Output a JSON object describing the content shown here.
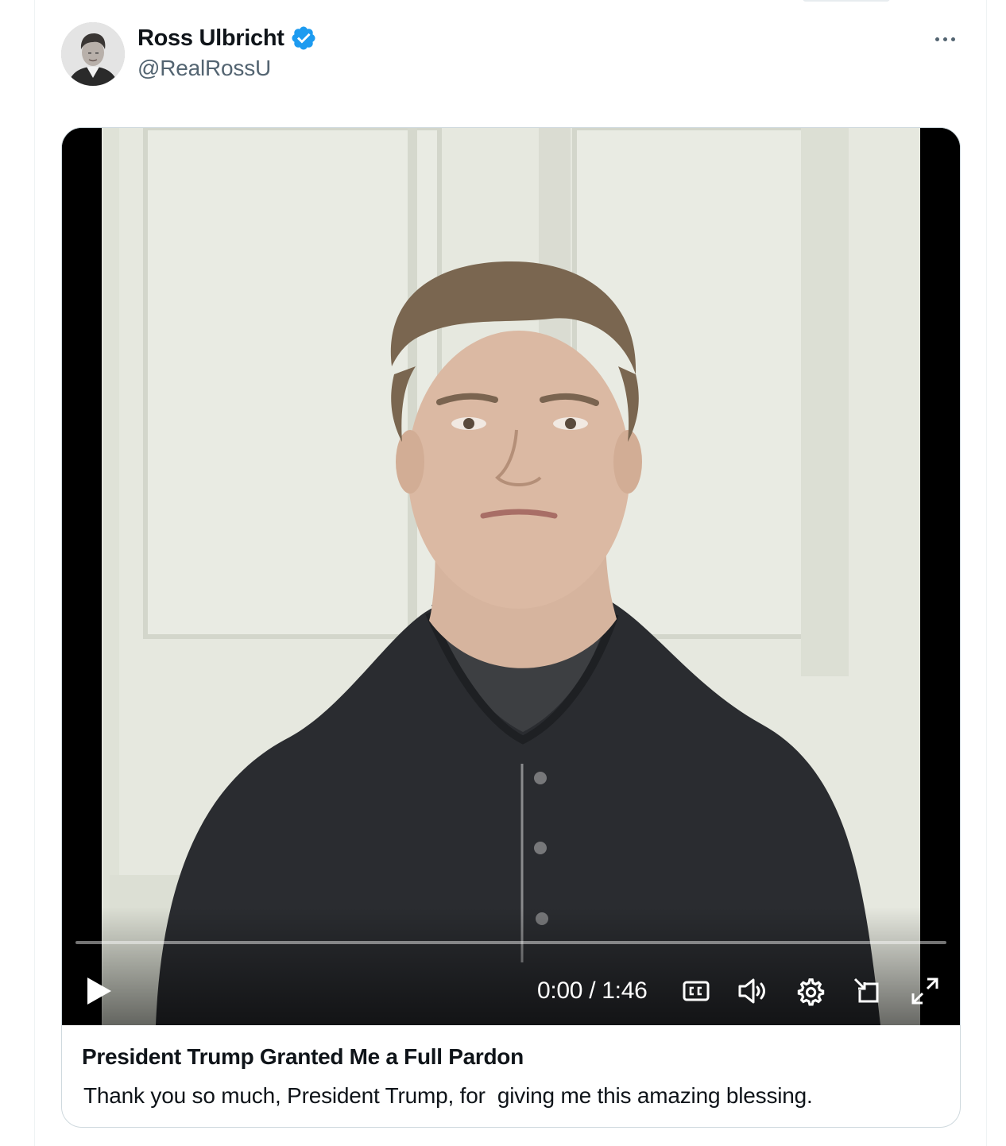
{
  "post": {
    "author": {
      "display_name": "Ross Ulbricht",
      "handle": "@RealRossU",
      "verified": true,
      "avatar_icon": "profile-photo"
    },
    "more_icon": "more-horizontal-icon"
  },
  "video": {
    "state": "paused",
    "progress": 0,
    "time_label": "0:00 / 1:46",
    "controls": [
      "play-icon",
      "captions-icon",
      "volume-icon",
      "settings-icon",
      "pop-out-icon",
      "fullscreen-icon"
    ]
  },
  "card": {
    "title": "President Trump Granted Me a Full Pardon",
    "description": "Thank you so much, President Trump, for  giving me this amazing blessing."
  },
  "colors": {
    "text_primary": "#0f1419",
    "text_secondary": "#536471",
    "verified_blue": "#1d9bf0",
    "border": "#cfd9de"
  }
}
